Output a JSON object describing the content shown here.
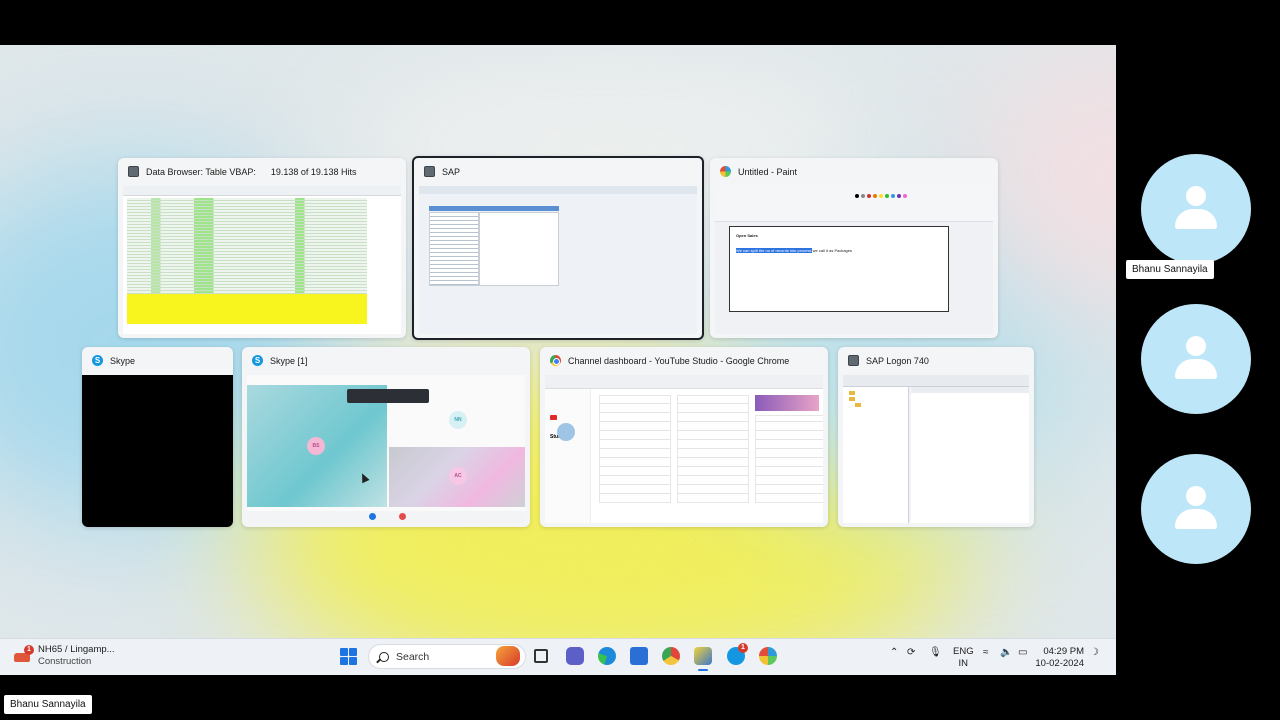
{
  "windows": {
    "data_browser": {
      "title": "Data Browser: Table VBAP:",
      "hits": "19.138 of     19.138 Hits"
    },
    "sap": {
      "title": "SAP"
    },
    "paint": {
      "title": "Untitled - Paint",
      "canvas_heading": "Open Sales",
      "canvas_text_highlight": "We can split the no of records into process",
      "canvas_text_rest": "we call it as Packages"
    },
    "skype_black": {
      "title": "Skype"
    },
    "skype_call": {
      "title": "Skype [1]",
      "avatar_bs": "BS",
      "avatar_nn": "NN",
      "avatar_ac": "AC"
    },
    "youtube": {
      "title": "Channel dashboard - YouTube Studio - Google Chrome",
      "logo": "Studio"
    },
    "sap_logon": {
      "title": "SAP Logon 740"
    }
  },
  "taskbar": {
    "weather_title": "NH65 / Lingamp...",
    "weather_sub": "Construction",
    "weather_badge": "1",
    "search_placeholder": "Search",
    "skype_badge": "1",
    "lang_top": "ENG",
    "lang_bottom": "IN",
    "time": "04:29 PM",
    "date": "10-02-2024"
  },
  "participants": {
    "tooltip_name": "Bhanu Sannayila",
    "self_name": "Bhanu Sannayila"
  },
  "colors": {
    "accent_blue": "#1e74e0",
    "highlight_yellow": "#f8f51e",
    "avatar_bg": "#bde6f8"
  }
}
